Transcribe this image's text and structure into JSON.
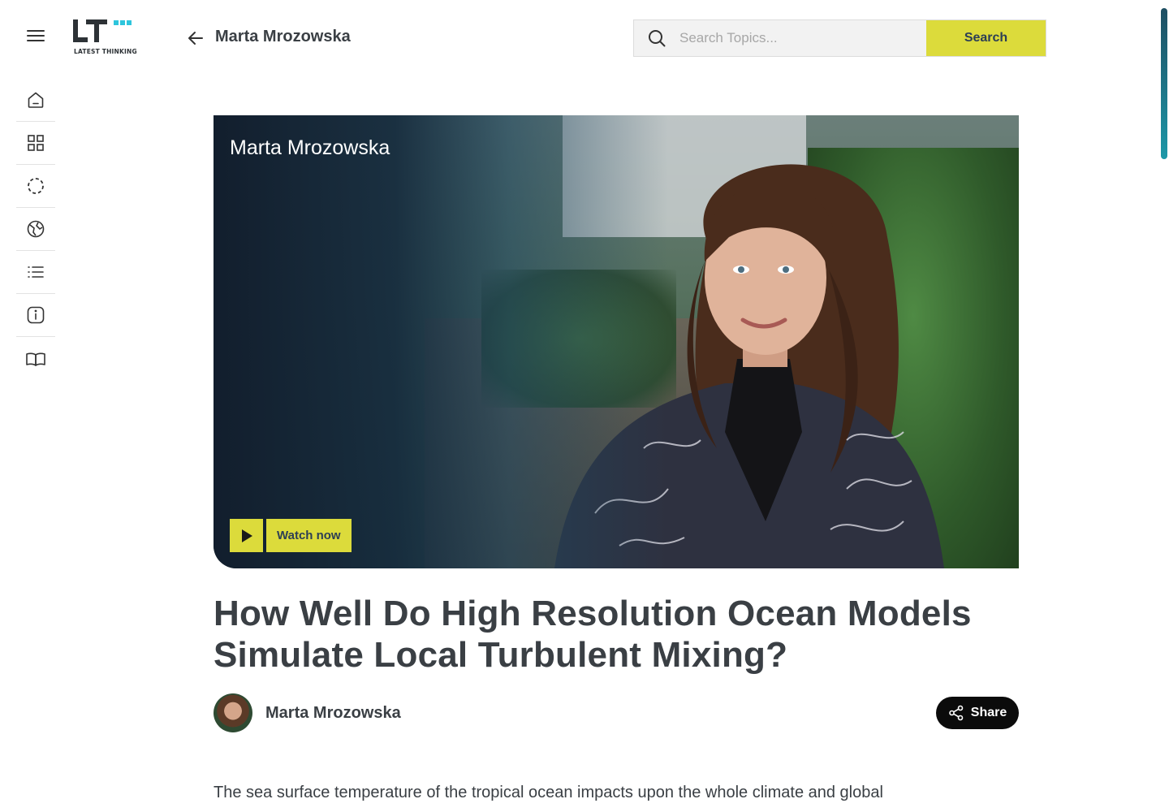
{
  "logo": {
    "text": "LT",
    "subtitle": "LATEST THINKING",
    "accent_color": "#2ec5dc"
  },
  "sidebar": {
    "items": [
      {
        "name": "home",
        "icon": "home-icon"
      },
      {
        "name": "categories",
        "icon": "grid-icon"
      },
      {
        "name": "loading",
        "icon": "dashed-circle-icon"
      },
      {
        "name": "globe",
        "icon": "globe-icon"
      },
      {
        "name": "list",
        "icon": "list-icon"
      },
      {
        "name": "info",
        "icon": "info-icon"
      },
      {
        "name": "read",
        "icon": "book-icon"
      }
    ]
  },
  "header": {
    "title": "Marta Mrozowska",
    "search": {
      "placeholder": "Search Topics...",
      "value": "",
      "button_label": "Search"
    }
  },
  "hero": {
    "name": "Marta Mrozowska",
    "watch_label": "Watch now"
  },
  "article": {
    "title": "How Well Do High Resolution Ocean Models Simulate Local Turbulent Mixing?",
    "author": "Marta Mrozowska",
    "share_label": "Share",
    "body_first_line": "The sea surface temperature of the tropical ocean impacts upon the whole climate and global"
  },
  "colors": {
    "accent_yellow": "#dcdb3b",
    "text_dark": "#3a3f44",
    "share_bg": "#0b0b0b"
  }
}
